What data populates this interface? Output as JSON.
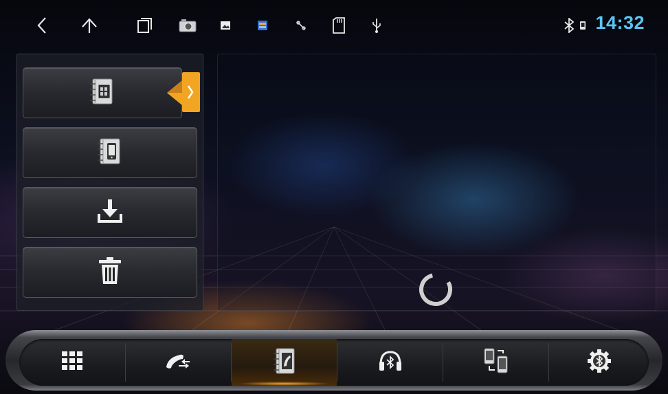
{
  "status_bar": {
    "time": "14:32",
    "icons": [
      "back-icon",
      "home-icon",
      "recent-apps-icon",
      "camera-icon",
      "gallery-icon",
      "media-icon",
      "gps-icon",
      "sd-card-icon",
      "usb-icon",
      "bluetooth-icon",
      "phone-small-icon"
    ]
  },
  "left_menu": {
    "items": [
      {
        "name": "sim-contacts",
        "icon": "sim-contacts-icon",
        "active": true
      },
      {
        "name": "phone-contacts",
        "icon": "phone-contacts-icon",
        "active": false
      },
      {
        "name": "download-contacts",
        "icon": "download-icon",
        "active": false
      },
      {
        "name": "delete-contacts",
        "icon": "trash-icon",
        "active": false
      }
    ]
  },
  "bottom_nav": {
    "items": [
      {
        "name": "dialpad",
        "icon": "dialpad-icon",
        "active": false
      },
      {
        "name": "call-log",
        "icon": "call-log-icon",
        "active": false
      },
      {
        "name": "contacts",
        "icon": "contacts-book-icon",
        "active": true
      },
      {
        "name": "bluetooth-music",
        "icon": "bluetooth-headphones-icon",
        "active": false
      },
      {
        "name": "device-transfer",
        "icon": "device-transfer-icon",
        "active": false
      },
      {
        "name": "bluetooth-settings",
        "icon": "bluetooth-settings-icon",
        "active": false
      }
    ]
  },
  "colors": {
    "clock": "#5bc6f2",
    "accent": "#f7a52a"
  }
}
